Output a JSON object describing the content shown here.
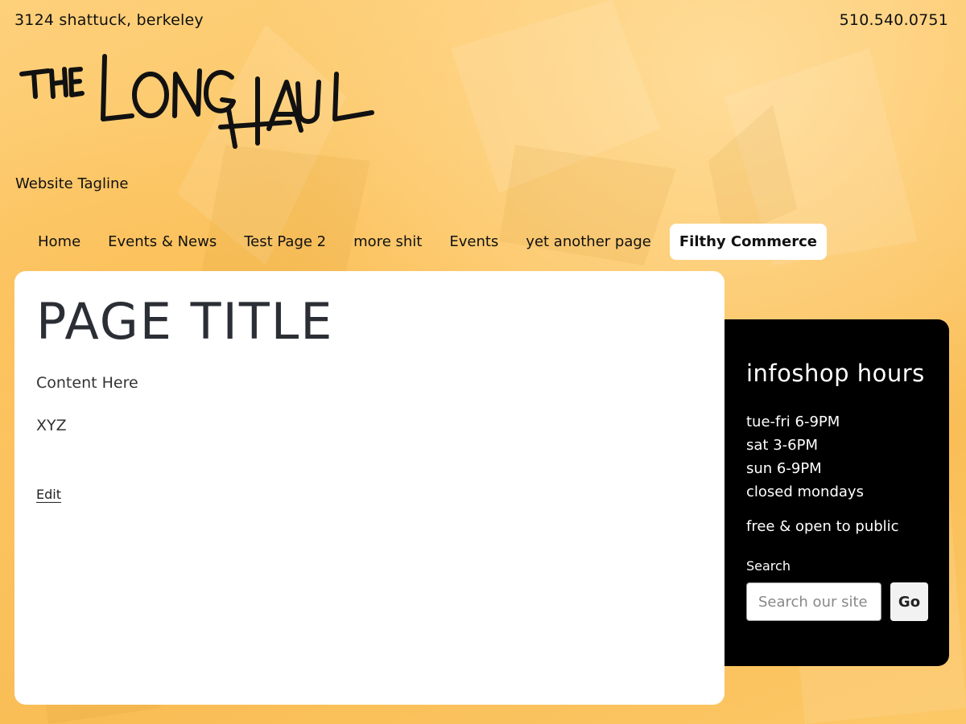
{
  "topbar": {
    "address": "3124 shattuck, berkeley",
    "phone": "510.540.0751"
  },
  "logo": {
    "text": "THE LONG HAUL"
  },
  "tagline": "Website Tagline",
  "nav": {
    "items": [
      {
        "label": "Home"
      },
      {
        "label": "Events & News"
      },
      {
        "label": "Test Page 2"
      },
      {
        "label": "more shit"
      },
      {
        "label": "Events"
      },
      {
        "label": "yet another page"
      },
      {
        "label": "Filthy Commerce",
        "active": true
      }
    ]
  },
  "main": {
    "title": "PAGE TITLE",
    "paragraphs": [
      "Content Here",
      "XYZ"
    ],
    "edit_label": "Edit"
  },
  "sidebar": {
    "title": "infoshop hours",
    "hours": [
      "tue-fri 6-9PM",
      "sat 3-6PM",
      "sun 6-9PM",
      "closed mondays"
    ],
    "note": "free & open to public",
    "search_label": "Search",
    "search_placeholder": "Search our site",
    "search_button": "Go"
  },
  "colors": {
    "background": "#fcc462",
    "sidebar": "#000000",
    "card": "#ffffff"
  }
}
